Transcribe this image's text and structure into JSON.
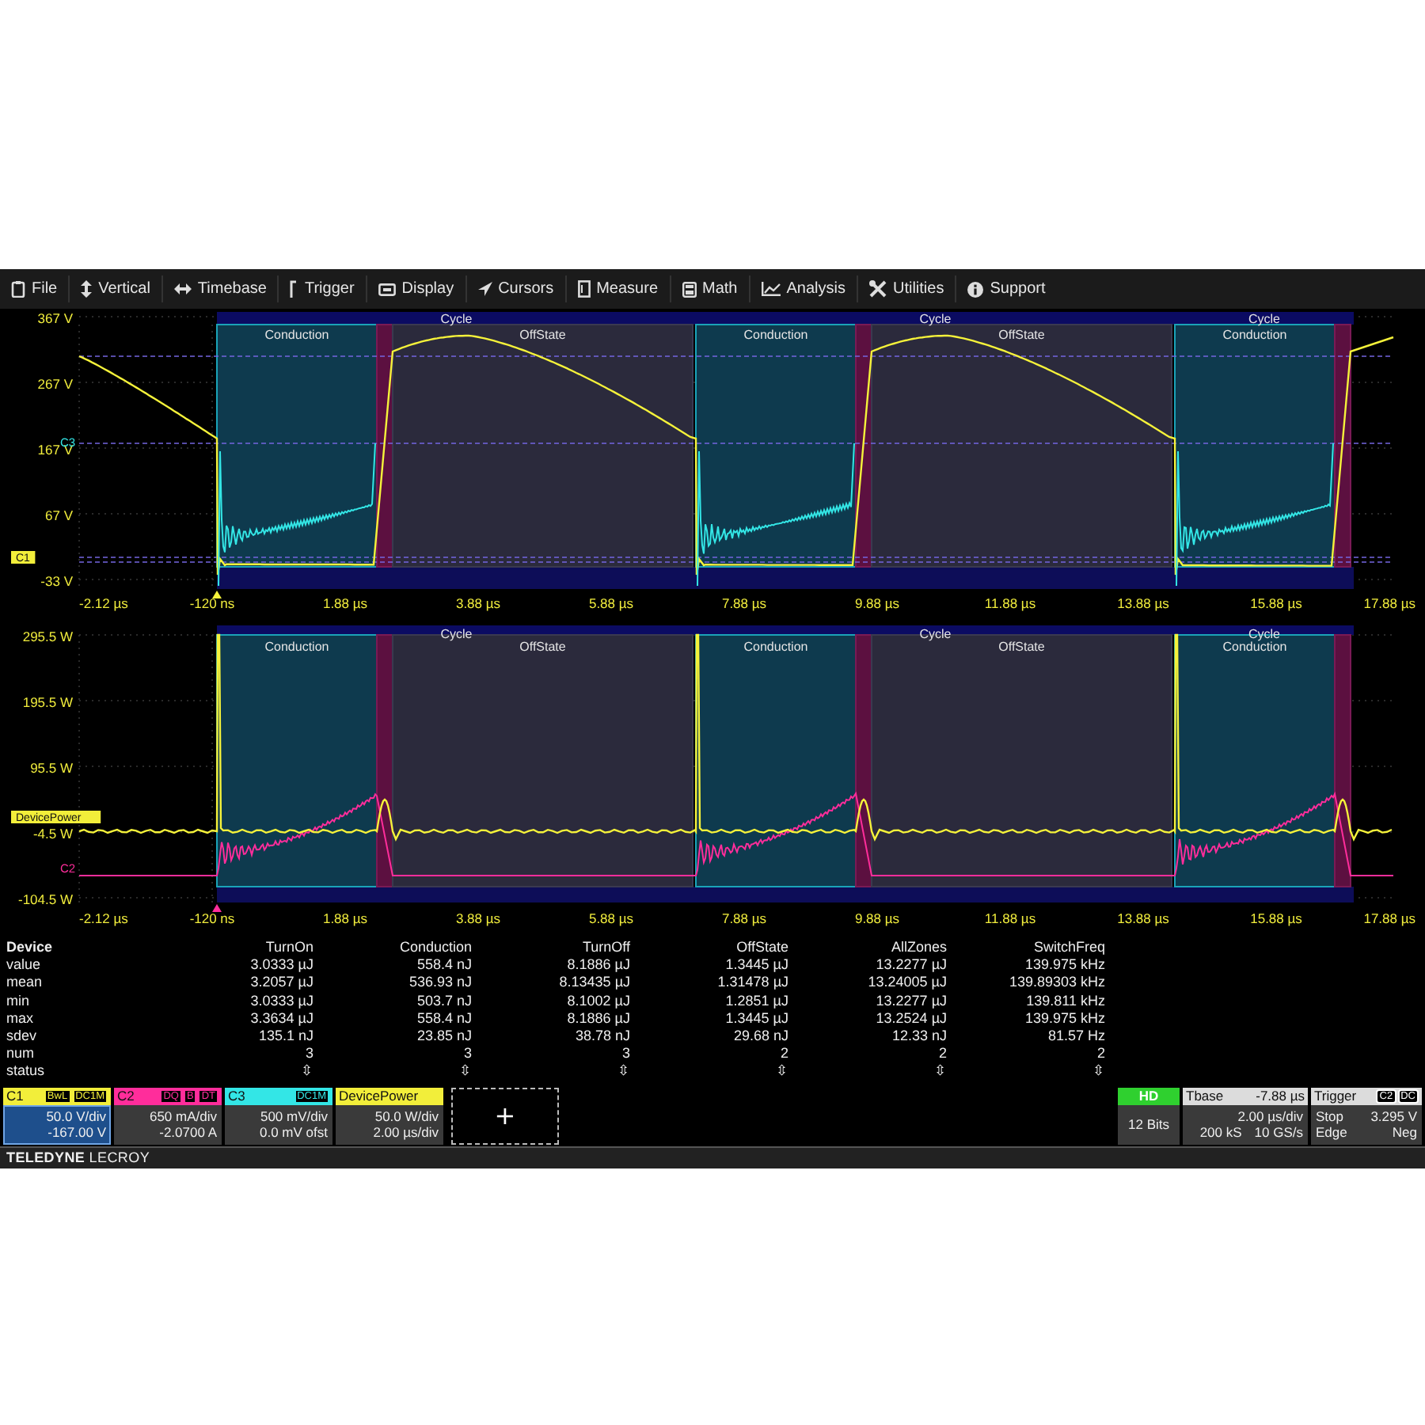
{
  "menu": [
    {
      "label": "File"
    },
    {
      "label": "Vertical"
    },
    {
      "label": "Timebase"
    },
    {
      "label": "Trigger"
    },
    {
      "label": "Display"
    },
    {
      "label": "Cursors"
    },
    {
      "label": "Measure"
    },
    {
      "label": "Math"
    },
    {
      "label": "Analysis"
    },
    {
      "label": "Utilities"
    },
    {
      "label": "Support"
    }
  ],
  "plots": [
    {
      "y_labels": [
        "367 V",
        "267 V",
        "167 V",
        "67 V",
        "-33 V"
      ],
      "x_labels": [
        "-2.12 µs",
        "-120 ns",
        "1.88 µs",
        "3.88 µs",
        "5.88 µs",
        "7.88 µs",
        "9.88 µs",
        "11.88 µs",
        "13.88 µs",
        "15.88 µs",
        "17.88 µs"
      ],
      "cycles": [
        {
          "label": "Cycle",
          "zones": [
            {
              "kind": "conduction",
              "label": "Conduction"
            },
            {
              "kind": "turnoff"
            },
            {
              "kind": "offstate",
              "label": "OffState"
            }
          ]
        },
        {
          "label": "Cycle",
          "zones": [
            {
              "kind": "conduction",
              "label": "Conduction"
            },
            {
              "kind": "turnoff"
            },
            {
              "kind": "offstate",
              "label": "OffState"
            }
          ]
        },
        {
          "label": "Cycle",
          "zones": [
            {
              "kind": "conduction",
              "label": "Conduction"
            },
            {
              "kind": "turnoff"
            }
          ]
        }
      ],
      "markers": [
        {
          "kind": "text",
          "label": "C3",
          "color": "#33e6e6"
        },
        {
          "kind": "tag",
          "label": "C1",
          "color": "#f2ee3a"
        }
      ]
    },
    {
      "y_labels": [
        "295.5 W",
        "195.5 W",
        "95.5 W",
        "-4.5 W",
        "-104.5 W"
      ],
      "x_labels": [
        "-2.12 µs",
        "-120 ns",
        "1.88 µs",
        "3.88 µs",
        "5.88 µs",
        "7.88 µs",
        "9.88 µs",
        "11.88 µs",
        "13.88 µs",
        "15.88 µs",
        "17.88 µs"
      ],
      "cycles": [
        {
          "label": "Cycle",
          "zones": [
            {
              "kind": "conduction",
              "label": "Conduction"
            },
            {
              "kind": "turnoff"
            },
            {
              "kind": "offstate",
              "label": "OffState"
            }
          ]
        },
        {
          "label": "Cycle",
          "zones": [
            {
              "kind": "conduction",
              "label": "Conduction"
            },
            {
              "kind": "turnoff"
            },
            {
              "kind": "offstate",
              "label": "OffState"
            }
          ]
        },
        {
          "label": "Cycle",
          "zones": [
            {
              "kind": "conduction",
              "label": "Conduction"
            },
            {
              "kind": "turnoff"
            }
          ]
        }
      ],
      "markers": [
        {
          "kind": "tag",
          "label": "DevicePower",
          "color": "#f2ee3a"
        },
        {
          "kind": "text",
          "label": "C2",
          "color": "#ff2d9b"
        }
      ]
    }
  ],
  "table": {
    "title": "Device",
    "columns": [
      "TurnOn",
      "Conduction",
      "TurnOff",
      "OffState",
      "AllZones",
      "SwitchFreq"
    ],
    "rows": [
      {
        "label": "value",
        "cells": [
          "3.0333 µJ",
          "558.4 nJ",
          "8.1886 µJ",
          "1.3445 µJ",
          "13.2277 µJ",
          "139.975 kHz"
        ]
      },
      {
        "label": "mean",
        "cells": [
          "3.2057 µJ",
          "536.93 nJ",
          "8.13435 µJ",
          "1.31478 µJ",
          "13.24005 µJ",
          "139.89303 kHz"
        ]
      },
      {
        "label": "min",
        "cells": [
          "3.0333 µJ",
          "503.7 nJ",
          "8.1002 µJ",
          "1.2851 µJ",
          "13.2277 µJ",
          "139.811 kHz"
        ]
      },
      {
        "label": "max",
        "cells": [
          "3.3634 µJ",
          "558.4 nJ",
          "8.1886 µJ",
          "1.3445 µJ",
          "13.2524 µJ",
          "139.975 kHz"
        ]
      },
      {
        "label": "sdev",
        "cells": [
          "135.1 nJ",
          "23.85 nJ",
          "38.78 nJ",
          "29.68 nJ",
          "12.33 nJ",
          "81.57 Hz"
        ]
      },
      {
        "label": "num",
        "cells": [
          "3",
          "3",
          "3",
          "2",
          "2",
          "2"
        ]
      },
      {
        "label": "status",
        "cells": [
          "⇳",
          "⇳",
          "⇳",
          "⇳",
          "⇳",
          "⇳"
        ]
      }
    ]
  },
  "channels": [
    {
      "label": "C1",
      "color": "#f2ee3a",
      "selected": true,
      "badges": [
        "BwL",
        "DC1M"
      ],
      "lines": [
        "50.0 V/div",
        "-167.00 V"
      ]
    },
    {
      "label": "C2",
      "color": "#ff2d9b",
      "selected": false,
      "badges": [
        "DQ",
        "B",
        "DT"
      ],
      "lines": [
        "650 mA/div",
        "-2.0700 A"
      ]
    },
    {
      "label": "C3",
      "color": "#33e6e6",
      "selected": false,
      "badges": [
        "DC1M"
      ],
      "lines": [
        "500 mV/div",
        "0.0 mV ofst"
      ]
    },
    {
      "label": "DevicePower",
      "color": "#f2ee3a",
      "selected": false,
      "lines": [
        "50.0 W/div",
        "2.00 µs/div"
      ]
    }
  ],
  "add_button": "+",
  "acquisition": {
    "badge": "HD",
    "text": "12 Bits"
  },
  "timebase": {
    "title": "Tbase",
    "value": "-7.88 µs",
    "lines": [
      [
        "2.00 µs/div"
      ],
      [
        "200 kS",
        "10 GS/s"
      ]
    ]
  },
  "trigger": {
    "title": "Trigger",
    "badges": [
      "C2",
      "DC"
    ],
    "rows": [
      [
        "Stop",
        "3.295 V"
      ],
      [
        "Edge",
        "Neg"
      ]
    ]
  },
  "footer": "**TELEDYNE** LECROY"
}
